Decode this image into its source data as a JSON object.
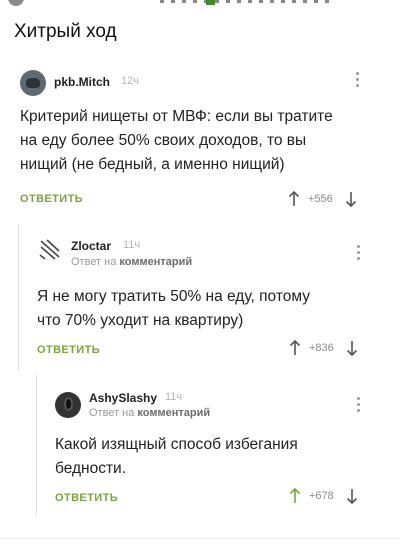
{
  "post": {
    "title": "Хитрый ход"
  },
  "comments": [
    {
      "author": "pkb.Mitch",
      "time": "12ч",
      "text_lines": [
        "Критерий нищеты от МВФ: если вы тратите",
        "на еду более 50% своих доходов, то вы",
        "нищий (не бедный, а именно нищий)"
      ],
      "reply_label": "ОТВЕТИТЬ",
      "score": "+556"
    },
    {
      "author": "Zloctar",
      "time": "11ч",
      "reply_prefix": "Ответ на",
      "reply_target": "комментарий",
      "text_lines": [
        "Я не могу тратить 50% на еду, потому",
        "что  70% уходит на квартиру)"
      ],
      "reply_label": "ОТВЕТИТЬ",
      "score": "+836"
    },
    {
      "author": "AshySlashy",
      "time": "11ч",
      "reply_prefix": "Ответ на",
      "reply_target": "комментарий",
      "text_lines": [
        "Какой изящный способ избегания",
        "бедности."
      ],
      "reply_label": "ОТВЕТИТЬ",
      "score": "+678"
    }
  ],
  "colors": {
    "accent": "#7aa53a",
    "muted": "#9a9a9a",
    "text": "#222222"
  }
}
